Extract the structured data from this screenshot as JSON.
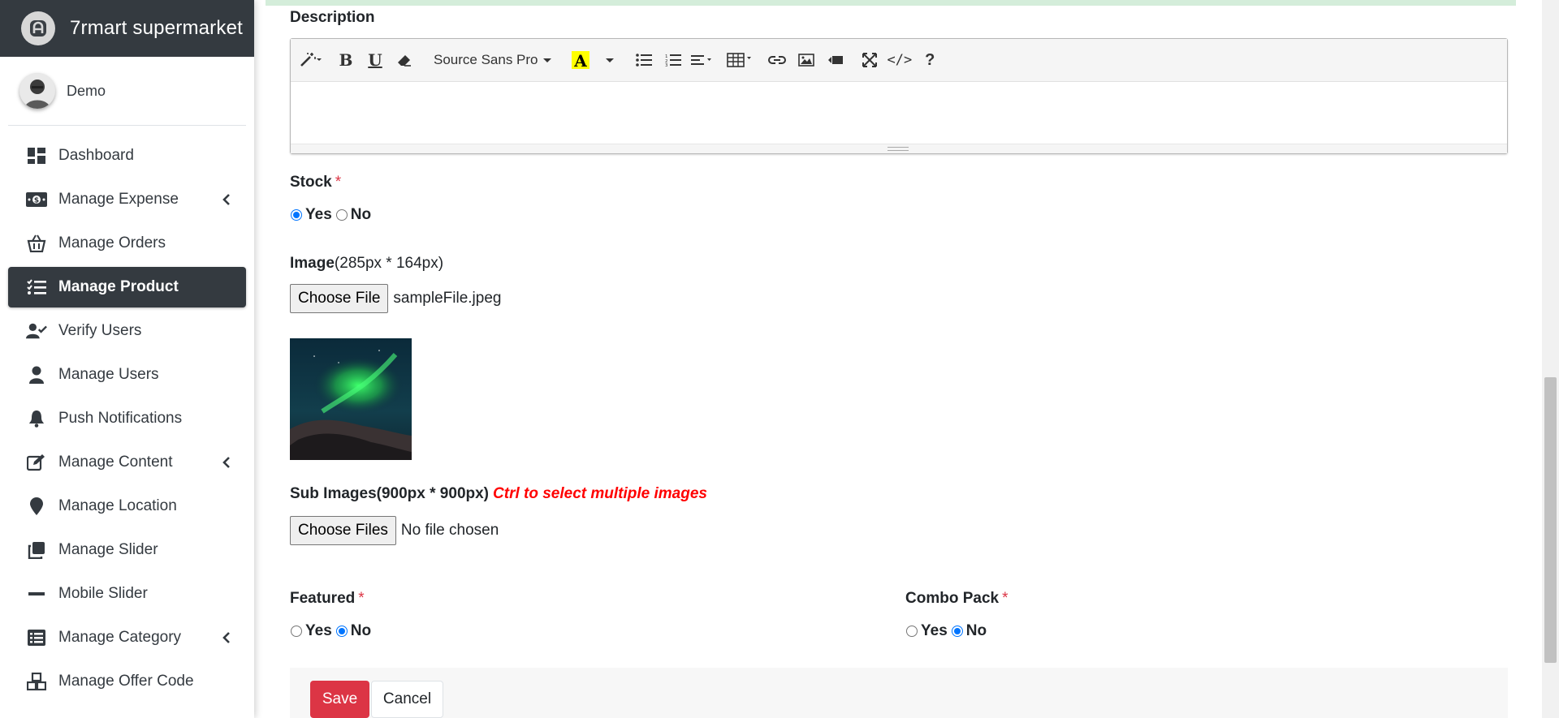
{
  "brand": {
    "name": "7rmart supermarket"
  },
  "user": {
    "name": "Demo"
  },
  "sidebar": {
    "items": [
      {
        "label": "Dashboard"
      },
      {
        "label": "Manage Expense"
      },
      {
        "label": "Manage Orders"
      },
      {
        "label": "Manage Product"
      },
      {
        "label": "Verify Users"
      },
      {
        "label": "Manage Users"
      },
      {
        "label": "Push Notifications"
      },
      {
        "label": "Manage Content"
      },
      {
        "label": "Manage Location"
      },
      {
        "label": "Manage Slider"
      },
      {
        "label": "Mobile Slider"
      },
      {
        "label": "Manage Category"
      },
      {
        "label": "Manage Offer Code"
      }
    ]
  },
  "form": {
    "description_label": "Description",
    "editor": {
      "font_name": "Source Sans Pro"
    },
    "stock": {
      "label": "Stock",
      "required": "*",
      "yes": "Yes",
      "no": "No",
      "selected": "Yes"
    },
    "image": {
      "label": "Image",
      "hint": "(285px * 164px)",
      "button": "Choose File",
      "file_name": "sampleFile.jpeg"
    },
    "sub_images": {
      "label": "Sub Images",
      "hint": "(900px * 900px)",
      "warning": "Ctrl to select multiple images",
      "button": "Choose Files",
      "file_name": "No file chosen"
    },
    "featured": {
      "label": "Featured",
      "required": "*",
      "yes": "Yes",
      "no": "No",
      "selected": "No"
    },
    "combo_pack": {
      "label": "Combo Pack",
      "required": "*",
      "yes": "Yes",
      "no": "No",
      "selected": "No"
    },
    "save": "Save",
    "cancel": "Cancel"
  },
  "colors": {
    "sidebar_dark": "#343a40",
    "active_radio": "#0075ff",
    "save_button": "#dc3545",
    "warning_text": "#ff0000",
    "success_strip": "#d4edda"
  }
}
